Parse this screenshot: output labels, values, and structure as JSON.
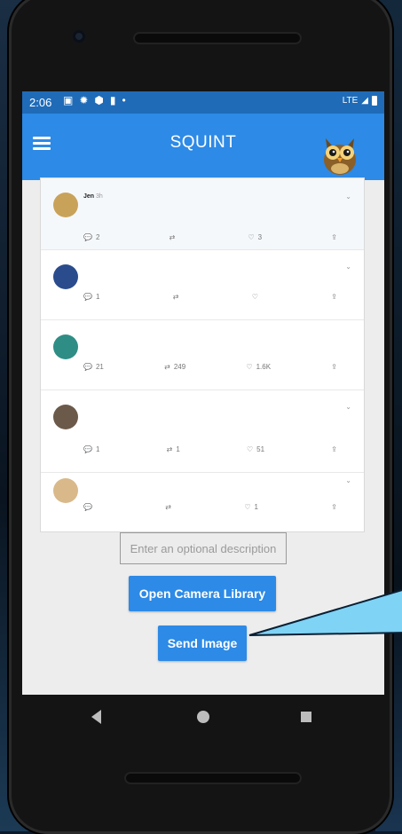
{
  "status_bar": {
    "time": "2:06",
    "icons": [
      "image-icon",
      "settings-icon",
      "shield-icon",
      "sd-card-icon",
      "dot-icon"
    ],
    "network": "LTE"
  },
  "app_bar": {
    "title": "SQUINT"
  },
  "screenshot": {
    "tweets": [
      {
        "context": "",
        "name": "Jen",
        "handle": "",
        "time": "3h",
        "body": "",
        "link": "",
        "replies": "2",
        "retweets": "",
        "likes": "3",
        "avatar_color": "#c9a25a"
      },
      {
        "context": "",
        "name": "",
        "handle": "",
        "time": "",
        "body": "",
        "link": "",
        "replies": "1",
        "retweets": "",
        "likes": "",
        "avatar_color": "#2b4c8c"
      },
      {
        "context": "",
        "name": "",
        "handle": "",
        "time": "",
        "body": "",
        "link": "",
        "replies": "21",
        "retweets": "249",
        "likes": "1.6K",
        "avatar_color": "#2e8e86"
      },
      {
        "context": "",
        "name": "",
        "handle": "",
        "time": "",
        "body": "",
        "link": "",
        "replies": "1",
        "retweets": "1",
        "likes": "51",
        "avatar_color": "#6b5a4a"
      },
      {
        "context": "",
        "name": "",
        "handle": "",
        "time": "",
        "body": "",
        "link": "",
        "replies": "",
        "retweets": "",
        "likes": "1",
        "avatar_color": "#d9b98a"
      }
    ]
  },
  "description_input": {
    "placeholder": "Enter an optional description"
  },
  "buttons": {
    "open_camera_library": "Open Camera Library",
    "send_image": "Send Image"
  },
  "colors": {
    "app_bar": "#2d8ae6",
    "status_bar": "#1f6bb8",
    "button": "#2d8ae6",
    "callout": "#7fd3f5"
  }
}
